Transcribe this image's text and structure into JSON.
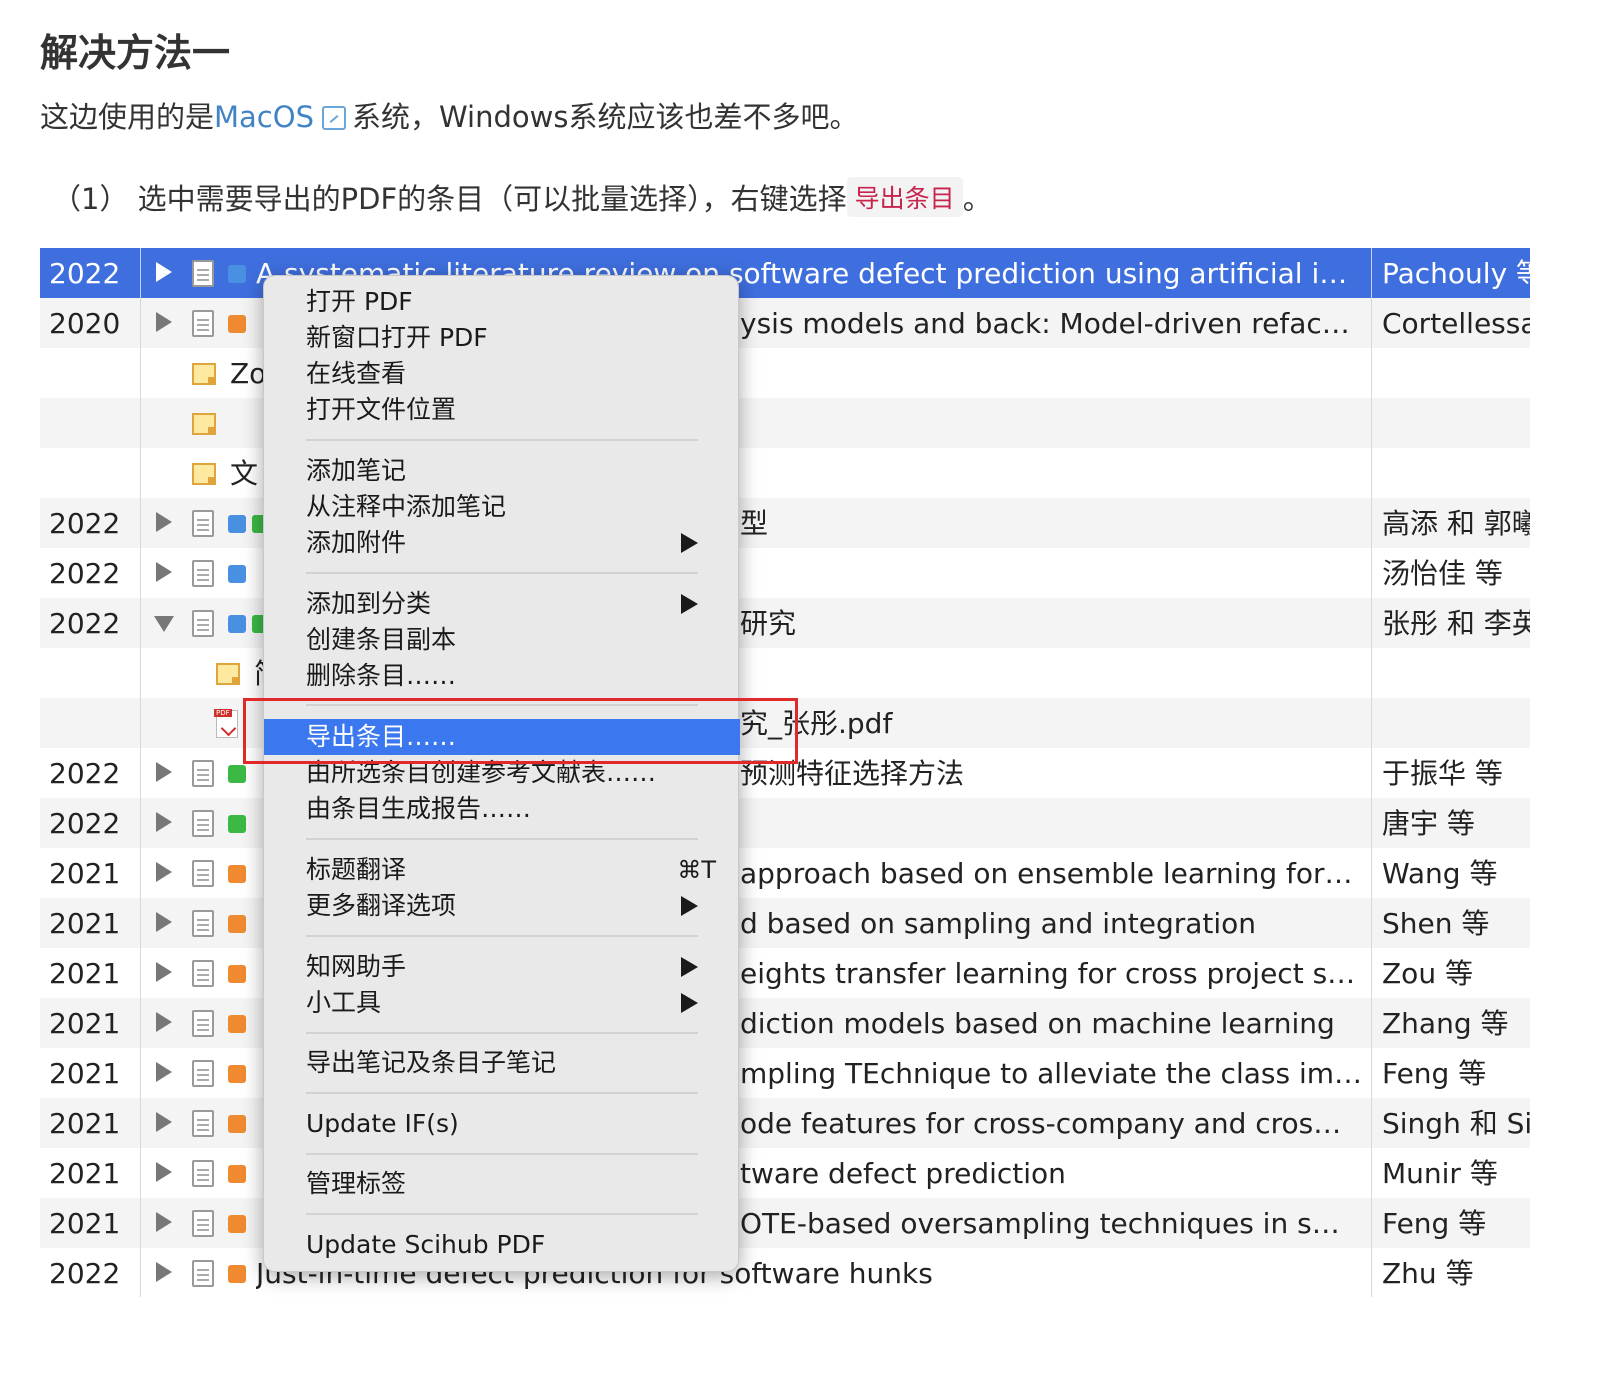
{
  "heading": "解决方法一",
  "para1": {
    "before": "这边使用的是",
    "link": "MacOS",
    "after": "系统，Windows系统应该也差不多吧。"
  },
  "para2": {
    "text": "（1） 选中需要导出的PDF的条目（可以批量选择），右键选择",
    "code": "导出条目",
    "end": "。"
  },
  "rows": [
    {
      "year": "2022",
      "title": "A systematic literature review on software defect prediction using artificial i…",
      "author": "Pachouly 等",
      "selected": true
    },
    {
      "year": "2020",
      "title": "ysis models and back: Model-driven refac…",
      "author": "Cortellessa"
    },
    {
      "title": "Zo"
    },
    {
      "title": ""
    },
    {
      "title": "文"
    },
    {
      "year": "2022",
      "title": "型",
      "author": "高添 和 郭曦"
    },
    {
      "year": "2022",
      "title": "",
      "author": "汤怡佳 等"
    },
    {
      "year": "2022",
      "title": "研究",
      "author": "张彤 和 李英"
    },
    {
      "title": "简"
    },
    {
      "title": "究_张彤.pdf"
    },
    {
      "year": "2022",
      "title": "预测特征选择方法",
      "author": "于振华 等"
    },
    {
      "year": "2022",
      "title": "",
      "author": "唐宇 等"
    },
    {
      "year": "2021",
      "title": "approach based on ensemble learning for…",
      "author": "Wang 等"
    },
    {
      "year": "2021",
      "title": "d based on sampling and integration",
      "author": "Shen 等"
    },
    {
      "year": "2021",
      "title": "eights transfer learning for cross project s…",
      "author": "Zou 等"
    },
    {
      "year": "2021",
      "title": "diction models based on machine learning",
      "author": "Zhang 等"
    },
    {
      "year": "2021",
      "title": "mpling TEchnique to alleviate the class im…",
      "author": "Feng 等"
    },
    {
      "year": "2021",
      "title": "ode features for cross-company and cros…",
      "author": "Singh 和 Si"
    },
    {
      "year": "2021",
      "title": "tware defect prediction",
      "author": "Munir 等"
    },
    {
      "year": "2021",
      "title": "OTE-based oversampling techniques in s…",
      "author": "Feng 等"
    },
    {
      "year": "2022",
      "title": "Just-in-time defect prediction for software hunks",
      "author": "Zhu 等"
    }
  ],
  "menu": {
    "open_pdf": "打开 PDF",
    "open_pdf_new_window": "新窗口打开 PDF",
    "view_online": "在线查看",
    "open_file_location": "打开文件位置",
    "add_note": "添加笔记",
    "add_note_from_annotations": "从注释中添加笔记",
    "add_attachment": "添加附件",
    "add_to_collection": "添加到分类",
    "duplicate_item": "创建条目副本",
    "delete_item": "删除条目……",
    "export_item": "导出条目……",
    "create_bibliography": "由所选条目创建参考文献表……",
    "generate_report": "由条目生成报告……",
    "translate_title": "标题翻译",
    "translate_title_shortcut": "⌘T",
    "more_translate": "更多翻译选项",
    "cnki_helper": "知网助手",
    "tools": "小工具",
    "export_notes": "导出笔记及条目子笔记",
    "update_if": "Update IF(s)",
    "manage_tags": "管理标签",
    "update_scihub": "Update Scihub PDF"
  }
}
